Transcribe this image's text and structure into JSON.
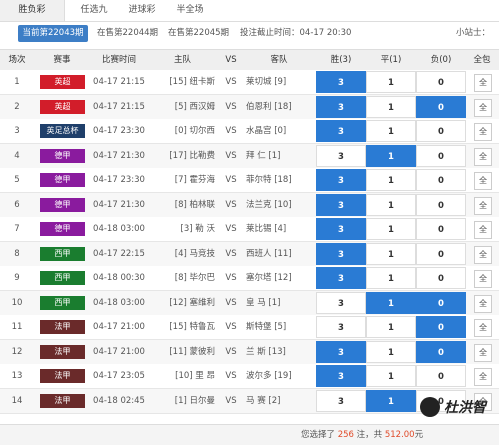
{
  "tabs": [
    "胜负彩",
    "任选九",
    "进球彩",
    "半全场"
  ],
  "issues": {
    "current": "当前第22043期",
    "next1": "在售第22044期",
    "next2": "在售第22045期",
    "deadline": "投注截止时间：04-17 20:30",
    "user": "小站士："
  },
  "headers": {
    "no": "场次",
    "league": "赛事",
    "time": "比赛时间",
    "home": "主队",
    "vs": "VS",
    "away": "客队",
    "win": "胜(3)",
    "draw": "平(1)",
    "lose": "负(0)",
    "all": "全包"
  },
  "colors": {
    "英超": "#d21d2a",
    "英足总杯": "#1f3f6a",
    "德甲": "#8a1b9e",
    "西甲": "#1a7d2f",
    "法甲": "#6a2a2a",
    "selected": "#2a7bd4"
  },
  "rows": [
    {
      "no": "1",
      "league": "英超",
      "time": "04-17 21:15",
      "home": "[15] 纽卡斯",
      "vs": "VS",
      "away": "莱切城 [9]",
      "w": "3",
      "d": "1",
      "l": "0",
      "all": "全",
      "sel": [
        true,
        false,
        false
      ]
    },
    {
      "no": "2",
      "league": "英超",
      "time": "04-17 21:15",
      "home": "[5] 西汉姆",
      "vs": "VS",
      "away": "伯恩利 [18]",
      "w": "3",
      "d": "1",
      "l": "0",
      "all": "全",
      "sel": [
        true,
        false,
        true
      ]
    },
    {
      "no": "3",
      "league": "英足总杯",
      "time": "04-17 23:30",
      "home": "[0] 切尔西",
      "vs": "VS",
      "away": "水晶宫 [0]",
      "w": "3",
      "d": "1",
      "l": "0",
      "all": "全",
      "sel": [
        true,
        false,
        false
      ]
    },
    {
      "no": "4",
      "league": "德甲",
      "time": "04-17 21:30",
      "home": "[17] 比勒费",
      "vs": "VS",
      "away": "拜 仁 [1]",
      "w": "3",
      "d": "1",
      "l": "0",
      "all": "全",
      "sel": [
        false,
        true,
        false
      ]
    },
    {
      "no": "5",
      "league": "德甲",
      "time": "04-17 23:30",
      "home": "[7] 霍芬海",
      "vs": "VS",
      "away": "菲尔特 [18]",
      "w": "3",
      "d": "1",
      "l": "0",
      "all": "全",
      "sel": [
        true,
        false,
        false
      ]
    },
    {
      "no": "6",
      "league": "德甲",
      "time": "04-17 21:30",
      "home": "[8] 柏林联",
      "vs": "VS",
      "away": "法兰克 [10]",
      "w": "3",
      "d": "1",
      "l": "0",
      "all": "全",
      "sel": [
        true,
        false,
        false
      ]
    },
    {
      "no": "7",
      "league": "德甲",
      "time": "04-18 03:00",
      "home": "[3] 勒 沃",
      "vs": "VS",
      "away": "莱比锡 [4]",
      "w": "3",
      "d": "1",
      "l": "0",
      "all": "全",
      "sel": [
        true,
        false,
        false
      ]
    },
    {
      "no": "8",
      "league": "西甲",
      "time": "04-17 22:15",
      "home": "[4] 马竞技",
      "vs": "VS",
      "away": "西班人 [11]",
      "w": "3",
      "d": "1",
      "l": "0",
      "all": "全",
      "sel": [
        true,
        false,
        false
      ]
    },
    {
      "no": "9",
      "league": "西甲",
      "time": "04-18 00:30",
      "home": "[8] 毕尔巴",
      "vs": "VS",
      "away": "塞尔塔 [12]",
      "w": "3",
      "d": "1",
      "l": "0",
      "all": "全",
      "sel": [
        true,
        false,
        false
      ]
    },
    {
      "no": "10",
      "league": "西甲",
      "time": "04-18 03:00",
      "home": "[12] 塞维利",
      "vs": "VS",
      "away": "皇 马 [1]",
      "w": "3",
      "d": "1",
      "l": "0",
      "all": "全",
      "sel": [
        false,
        true,
        true
      ]
    },
    {
      "no": "11",
      "league": "法甲",
      "time": "04-17 21:00",
      "home": "[15] 特鲁瓦",
      "vs": "VS",
      "away": "斯特堡 [5]",
      "w": "3",
      "d": "1",
      "l": "0",
      "all": "全",
      "sel": [
        false,
        false,
        true
      ]
    },
    {
      "no": "12",
      "league": "法甲",
      "time": "04-17 21:00",
      "home": "[11] 蒙彼利",
      "vs": "VS",
      "away": "兰 斯 [13]",
      "w": "3",
      "d": "1",
      "l": "0",
      "all": "全",
      "sel": [
        true,
        false,
        true
      ]
    },
    {
      "no": "13",
      "league": "法甲",
      "time": "04-17 23:05",
      "home": "[10] 里 昂",
      "vs": "VS",
      "away": "波尔多 [19]",
      "w": "3",
      "d": "1",
      "l": "0",
      "all": "全",
      "sel": [
        true,
        false,
        false
      ]
    },
    {
      "no": "14",
      "league": "法甲",
      "time": "04-18 02:45",
      "home": "[1] 日尔曼",
      "vs": "VS",
      "away": "马 赛 [2]",
      "w": "3",
      "d": "1",
      "l": "0",
      "all": "全",
      "sel": [
        false,
        true,
        false
      ]
    }
  ],
  "footer": {
    "prefix": "您选择了 ",
    "bets": "256",
    "middle": " 注，共 ",
    "amount": "512.00",
    "suffix": "元"
  },
  "watermark": "杜洪智"
}
